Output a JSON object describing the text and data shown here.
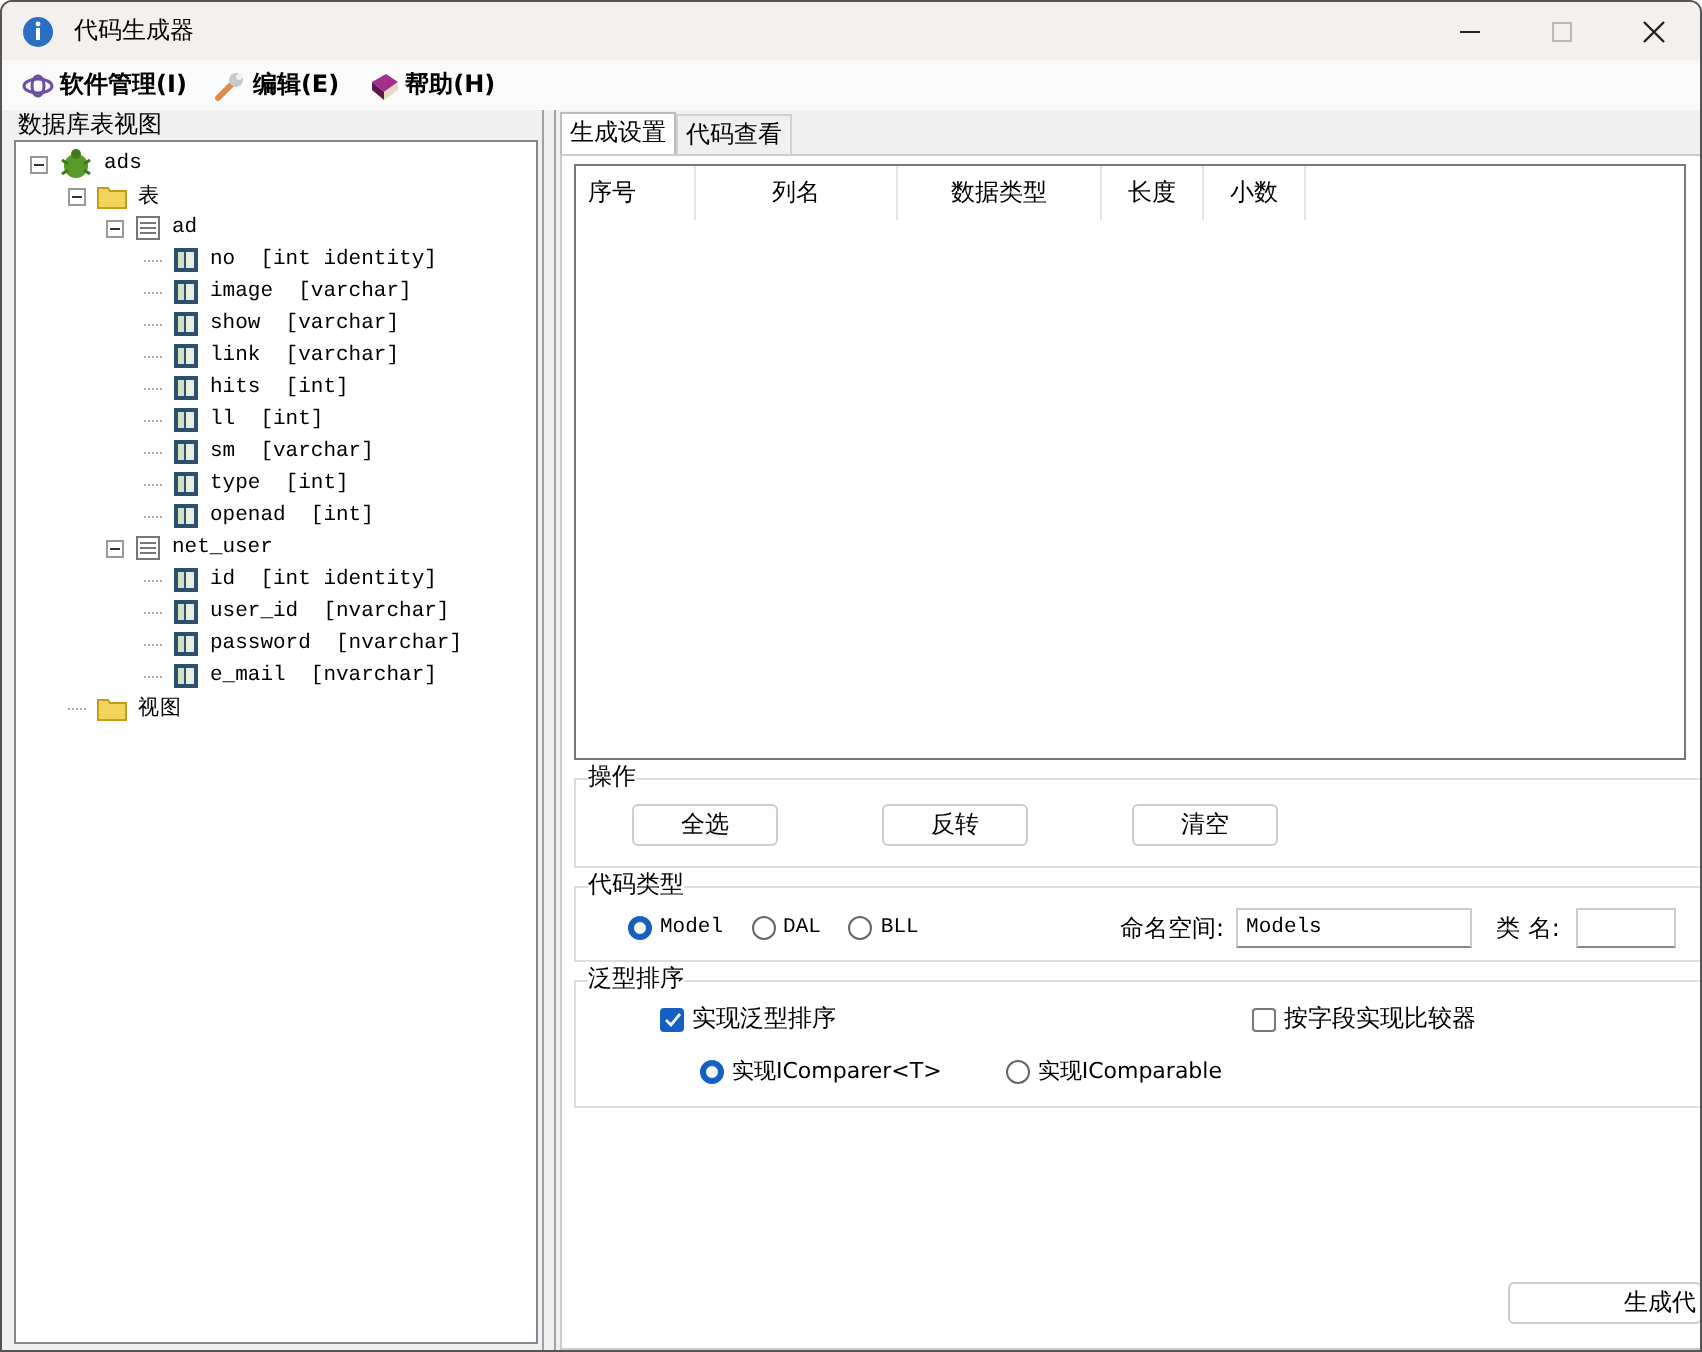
{
  "window": {
    "title": "代码生成器"
  },
  "menu": [
    {
      "label": "软件管理(I)"
    },
    {
      "label": "编辑(E)"
    },
    {
      "label": "帮助(H)"
    }
  ],
  "left_panel": {
    "title": "数据库表视图",
    "tree": [
      {
        "label": "ads",
        "kind": "database",
        "expanded": true,
        "children": [
          {
            "label": "表",
            "kind": "folder",
            "expanded": true,
            "children": [
              {
                "label": "ad",
                "kind": "table",
                "expanded": true,
                "children": [
                  {
                    "label": "no  [int identity]",
                    "kind": "column"
                  },
                  {
                    "label": "image  [varchar]",
                    "kind": "column"
                  },
                  {
                    "label": "show  [varchar]",
                    "kind": "column"
                  },
                  {
                    "label": "link  [varchar]",
                    "kind": "column"
                  },
                  {
                    "label": "hits  [int]",
                    "kind": "column"
                  },
                  {
                    "label": "ll  [int]",
                    "kind": "column"
                  },
                  {
                    "label": "sm  [varchar]",
                    "kind": "column"
                  },
                  {
                    "label": "type  [int]",
                    "kind": "column"
                  },
                  {
                    "label": "openad  [int]",
                    "kind": "column"
                  }
                ]
              },
              {
                "label": "net_user",
                "kind": "table",
                "expanded": true,
                "children": [
                  {
                    "label": "id  [int identity]",
                    "kind": "column"
                  },
                  {
                    "label": "user_id  [nvarchar]",
                    "kind": "column"
                  },
                  {
                    "label": "password  [nvarchar]",
                    "kind": "column"
                  },
                  {
                    "label": "e_mail  [nvarchar]",
                    "kind": "column"
                  }
                ]
              }
            ]
          },
          {
            "label": "视图",
            "kind": "folder"
          }
        ]
      }
    ]
  },
  "tabs": [
    {
      "label": "生成设置",
      "selected": true
    },
    {
      "label": "代码查看",
      "selected": false
    }
  ],
  "table": {
    "columns": [
      "序号",
      "列名",
      "数据类型",
      "长度",
      "小数"
    ]
  },
  "operations": {
    "title": "操作",
    "buttons": [
      "全选",
      "反转",
      "清空"
    ]
  },
  "code_type": {
    "title": "代码类型",
    "options": [
      {
        "label": "Model",
        "selected": true
      },
      {
        "label": "DAL",
        "selected": false
      },
      {
        "label": "BLL",
        "selected": false
      }
    ],
    "namespace_label": "命名空间:",
    "namespace_value": "Models",
    "class_label": "类 名:"
  },
  "generic_sort": {
    "title": "泛型排序",
    "implement": {
      "label": "实现泛型排序",
      "checked": true
    },
    "by_field": {
      "label": "按字段实现比较器",
      "checked": false
    },
    "options": [
      {
        "label": "实现IComparer<T>",
        "selected": true
      },
      {
        "label": "实现IComparable",
        "selected": false
      }
    ]
  },
  "generate_button": "生成代"
}
